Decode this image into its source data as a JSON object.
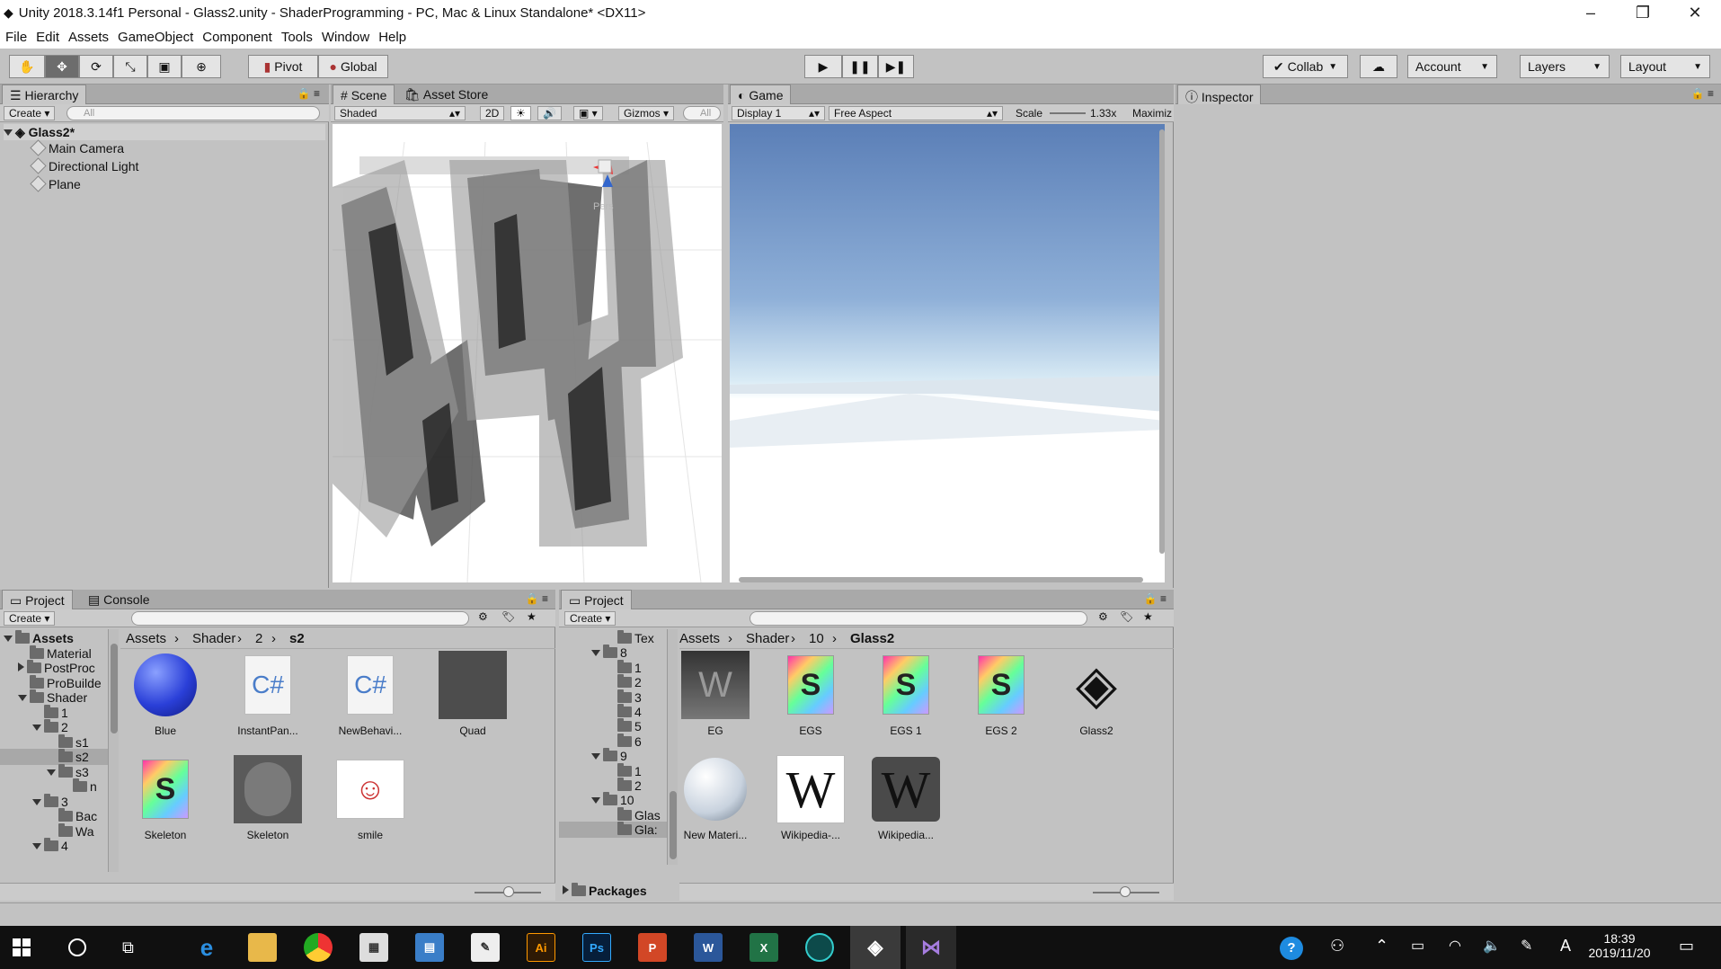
{
  "window": {
    "title": "Unity 2018.3.14f1 Personal - Glass2.unity - ShaderProgramming - PC, Mac & Linux Standalone* <DX11>",
    "min": "–",
    "max": "❐",
    "close": "✕"
  },
  "menu": [
    "File",
    "Edit",
    "Assets",
    "GameObject",
    "Component",
    "Tools",
    "Window",
    "Help"
  ],
  "toolbar": {
    "pivot": "Pivot",
    "global": "Global",
    "collab": "Collab",
    "account": "Account",
    "layers": "Layers",
    "layout": "Layout"
  },
  "hierarchy": {
    "tab": "Hierarchy",
    "create": "Create",
    "search_placeholder": "All",
    "scene": "Glass2*",
    "items": [
      "Main Camera",
      "Directional Light",
      "Plane"
    ]
  },
  "scene": {
    "tab": "Scene",
    "tab2": "Asset Store",
    "shading": "Shaded",
    "mode2d": "2D",
    "gizmos": "Gizmos",
    "search": "All",
    "axis_label": "Pers"
  },
  "game": {
    "tab": "Game",
    "display": "Display 1",
    "aspect": "Free Aspect",
    "scale_label": "Scale",
    "scale_value": "1.33x",
    "maximize": "Maximiz"
  },
  "inspector": {
    "tab": "Inspector"
  },
  "project_left": {
    "tab": "Project",
    "tab2": "Console",
    "create": "Create",
    "tree": [
      {
        "label": "Assets",
        "depth": 0,
        "open": true,
        "bold": true
      },
      {
        "label": "Material",
        "depth": 1
      },
      {
        "label": "PostProc",
        "depth": 1,
        "closed": true
      },
      {
        "label": "ProBuilde",
        "depth": 1
      },
      {
        "label": "Shader",
        "depth": 1,
        "open": true
      },
      {
        "label": "1",
        "depth": 2
      },
      {
        "label": "2",
        "depth": 2,
        "open": true
      },
      {
        "label": "s1",
        "depth": 3
      },
      {
        "label": "s2",
        "depth": 3,
        "selected": true
      },
      {
        "label": "s3",
        "depth": 3,
        "open": true
      },
      {
        "label": "n",
        "depth": 4
      },
      {
        "label": "3",
        "depth": 2,
        "open": true
      },
      {
        "label": "Bac",
        "depth": 3
      },
      {
        "label": "Wa",
        "depth": 3
      },
      {
        "label": "4",
        "depth": 2,
        "open": true
      }
    ],
    "breadcrumb": [
      "Assets",
      "Shader",
      "2",
      "s2"
    ],
    "assets": [
      {
        "name": "Blue",
        "kind": "sphere-blue"
      },
      {
        "name": "InstantPan...",
        "kind": "csharp"
      },
      {
        "name": "NewBehavi...",
        "kind": "csharp"
      },
      {
        "name": "Quad",
        "kind": "quad"
      },
      {
        "name": "Skeleton",
        "kind": "shader"
      },
      {
        "name": "Skeleton",
        "kind": "material-gray"
      },
      {
        "name": "smile",
        "kind": "image"
      }
    ]
  },
  "project_right": {
    "tab": "Project",
    "create": "Create",
    "tree": [
      {
        "label": "Tex",
        "depth": 3
      },
      {
        "label": "8",
        "depth": 2,
        "open": true
      },
      {
        "label": "1",
        "depth": 3
      },
      {
        "label": "2",
        "depth": 3
      },
      {
        "label": "3",
        "depth": 3
      },
      {
        "label": "4",
        "depth": 3
      },
      {
        "label": "5",
        "depth": 3
      },
      {
        "label": "6",
        "depth": 3
      },
      {
        "label": "9",
        "depth": 2,
        "open": true
      },
      {
        "label": "1",
        "depth": 3
      },
      {
        "label": "2",
        "depth": 3
      },
      {
        "label": "10",
        "depth": 2,
        "open": true
      },
      {
        "label": "Glas",
        "depth": 3
      },
      {
        "label": "Gla:",
        "depth": 3,
        "selected": true
      }
    ],
    "packages": "Packages",
    "breadcrumb": [
      "Assets",
      "Shader",
      "10",
      "Glass2"
    ],
    "assets": [
      {
        "name": "EG",
        "kind": "eg"
      },
      {
        "name": "EGS",
        "kind": "shader"
      },
      {
        "name": "EGS 1",
        "kind": "shader"
      },
      {
        "name": "EGS 2",
        "kind": "shader"
      },
      {
        "name": "Glass2",
        "kind": "unity"
      },
      {
        "name": "New Materi...",
        "kind": "sphere-white"
      },
      {
        "name": "Wikipedia-...",
        "kind": "wiki"
      },
      {
        "name": "Wikipedia...",
        "kind": "wiki-dark"
      }
    ]
  },
  "taskbar": {
    "time": "18:39",
    "date": "2019/11/20",
    "ime": "A",
    "apps": [
      "edge",
      "explorer",
      "chrome",
      "store",
      "control-panel",
      "clip-studio",
      "illustrator",
      "photoshop",
      "powerpoint",
      "word",
      "excel",
      "git-kraken",
      "unity",
      "visual-studio"
    ],
    "app_labels": {
      "illustrator": "Ai",
      "photoshop": "Ps",
      "powerpoint": "P",
      "word": "W",
      "excel": "X"
    }
  }
}
